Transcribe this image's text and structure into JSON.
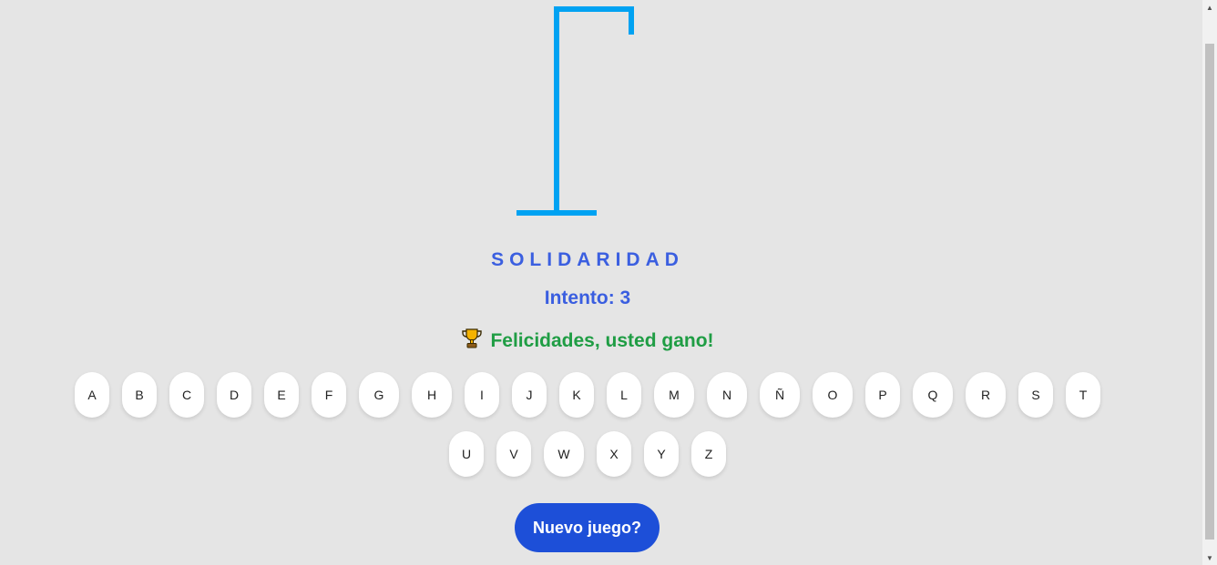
{
  "game": {
    "word": "SOLIDARIDAD",
    "attempts_text": "Intento: 3",
    "message": "Felicidades, usted gano!",
    "message_icon": "trophy-icon",
    "accent_color": "#3b5fe0",
    "success_color": "#1f9d44",
    "gallows_color": "#00a2f2"
  },
  "keyboard": {
    "row1": [
      "A",
      "B",
      "C",
      "D",
      "E",
      "F",
      "G",
      "H",
      "I",
      "J",
      "K",
      "L",
      "M",
      "N",
      "Ñ",
      "O",
      "P",
      "Q",
      "R",
      "S",
      "T"
    ],
    "row2": [
      "U",
      "V",
      "W",
      "X",
      "Y",
      "Z"
    ]
  },
  "actions": {
    "new_game_label": "Nuevo juego?",
    "button_color": "#1d4fd8"
  }
}
